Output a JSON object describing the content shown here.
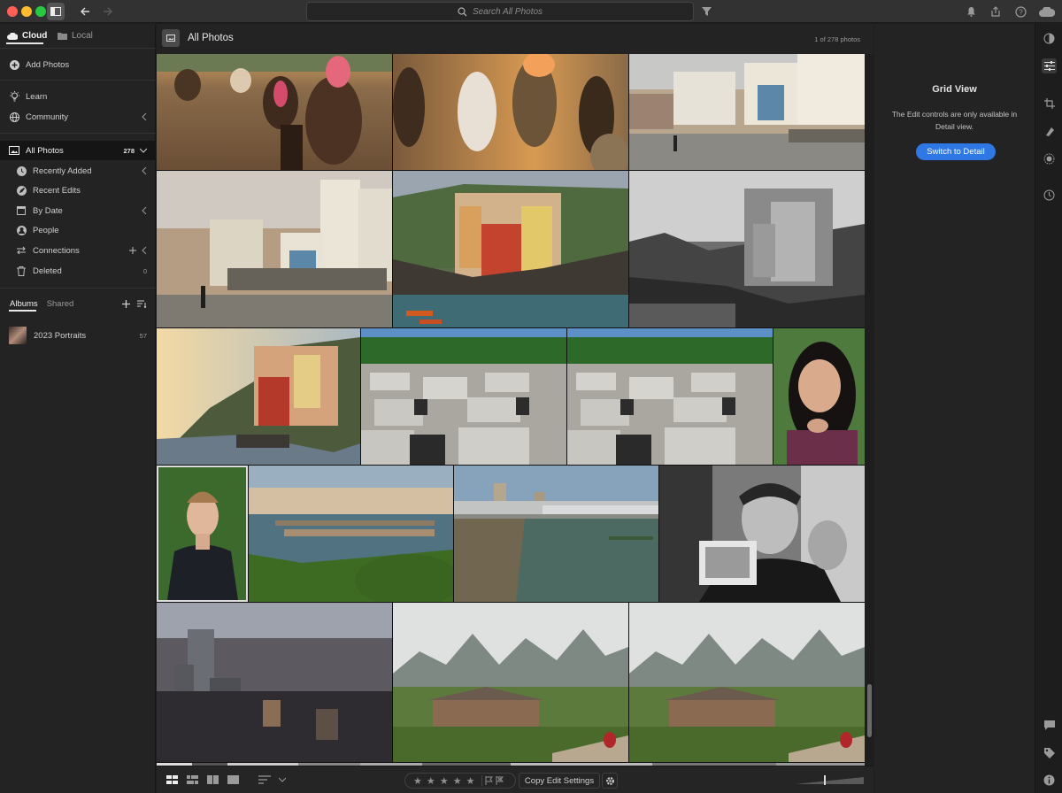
{
  "titlebar": {
    "search_placeholder": "Search All Photos",
    "icons": [
      "panel-toggle-icon",
      "back-arrow-icon",
      "forward-arrow-icon",
      "search-icon",
      "filter-icon",
      "bell-icon",
      "share-icon",
      "help-icon",
      "cloud-icon"
    ]
  },
  "left_panel": {
    "tabs": {
      "cloud": "Cloud",
      "local": "Local"
    },
    "add_photos": "Add Photos",
    "learn": "Learn",
    "community": "Community",
    "all_photos": {
      "label": "All Photos",
      "count": "278"
    },
    "library_items": [
      {
        "label": "Recently Added",
        "count": ""
      },
      {
        "label": "Recent Edits",
        "count": ""
      },
      {
        "label": "By Date",
        "count": ""
      },
      {
        "label": "People",
        "count": ""
      },
      {
        "label": "Connections",
        "count": ""
      },
      {
        "label": "Deleted",
        "count": "0"
      }
    ],
    "albums_tab": "Albums",
    "shared_tab": "Shared",
    "albums": [
      {
        "label": "2023 Portraits",
        "count": "57"
      }
    ]
  },
  "header": {
    "title": "All Photos",
    "count": "1 of 278 photos"
  },
  "grid": {
    "photos": [
      "horse-riders-sunset-1",
      "horse-riders-sunset-2",
      "colonial-church-street-1",
      "colonial-church-street-2",
      "cliffside-village-boats",
      "cliffside-village-bw",
      "cliffside-village-sunset",
      "memorial-concrete-blocks-1",
      "memorial-concrete-blocks-2",
      "portrait-woman-green",
      "portrait-man-forest",
      "river-bridge-city",
      "harbor-marina-towers",
      "portrait-man-bw",
      "city-skyline-dusk",
      "karst-mountains-house-1",
      "karst-mountains-house-2"
    ]
  },
  "bottom_toolbar": {
    "copy_edit_settings": "Copy Edit Settings",
    "stars": "★ ★ ★ ★ ★",
    "icons": [
      "square-grid-icon",
      "photo-grid-icon",
      "detail-view-icon",
      "single-view-icon",
      "sort-icon",
      "chevron-down-icon",
      "flag-icon",
      "reject-flag-icon",
      "gear-icon",
      "thumbnail-size-slider"
    ]
  },
  "right_panel": {
    "title": "Grid View",
    "message": "The Edit controls are only available in Detail view.",
    "button": "Switch to Detail"
  },
  "tool_strip": {
    "icons": [
      "presets-icon",
      "edit-sliders-icon",
      "crop-icon",
      "healing-icon",
      "masking-icon",
      "history-icon",
      "comment-icon",
      "tag-icon",
      "info-icon"
    ]
  },
  "colors": {
    "accent_blue": "#2e77e5",
    "panel_bg": "#232323",
    "titlebar_bg": "#323232"
  }
}
